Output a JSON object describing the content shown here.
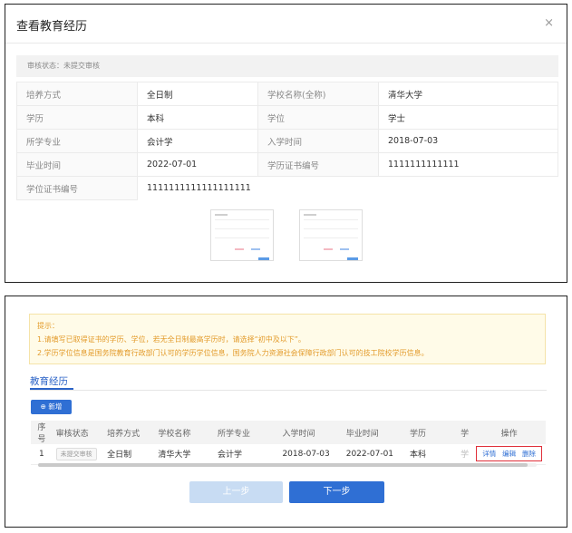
{
  "modal": {
    "title": "查看教育经历",
    "close_glyph": "×",
    "status_text": "审核状态：未提交审核",
    "rows": [
      {
        "k1": "培养方式",
        "v1": "全日制",
        "k2": "学校名称(全称)",
        "v2": "清华大学"
      },
      {
        "k1": "学历",
        "v1": "本科",
        "k2": "学位",
        "v2": "学士"
      },
      {
        "k1": "所学专业",
        "v1": "会计学",
        "k2": "入学时间",
        "v2": "2018-07-03"
      },
      {
        "k1": "毕业时间",
        "v1": "2022-07-01",
        "k2": "学历证书编号",
        "v2": "1111111111111"
      }
    ],
    "last_row": {
      "k": "学位证书编号",
      "v": "1111111111111111111"
    }
  },
  "tips": {
    "title": "提示：",
    "line1": "1.请填写已取得证书的学历、学位，若无全日制最高学历时，请选择“初中及以下”。",
    "line2": "2.学历学位信息是国务院教育行政部门认可的学历学位信息，国务院人力资源社会保障行政部门认可的技工院校学历信息。"
  },
  "section": {
    "title": "教育经历",
    "add_label": "新增"
  },
  "table": {
    "headers": [
      "序号",
      "审核状态",
      "培养方式",
      "学校名称",
      "所学专业",
      "入学时间",
      "毕业时间",
      "学历",
      "学",
      "操作"
    ],
    "row": {
      "index": "1",
      "status": "未提交审核",
      "mode": "全日制",
      "school": "清华大学",
      "major": "会计学",
      "start": "2018-07-03",
      "end": "2022-07-01",
      "degree": "本科",
      "cut": "学"
    },
    "ops": [
      "详情",
      "编辑",
      "删除"
    ]
  },
  "nav": {
    "prev": "上一步",
    "next": "下一步"
  },
  "colors": {
    "primary": "#2f6fd4",
    "highlight": "#e0303a",
    "tip_text": "#e39b2b"
  }
}
